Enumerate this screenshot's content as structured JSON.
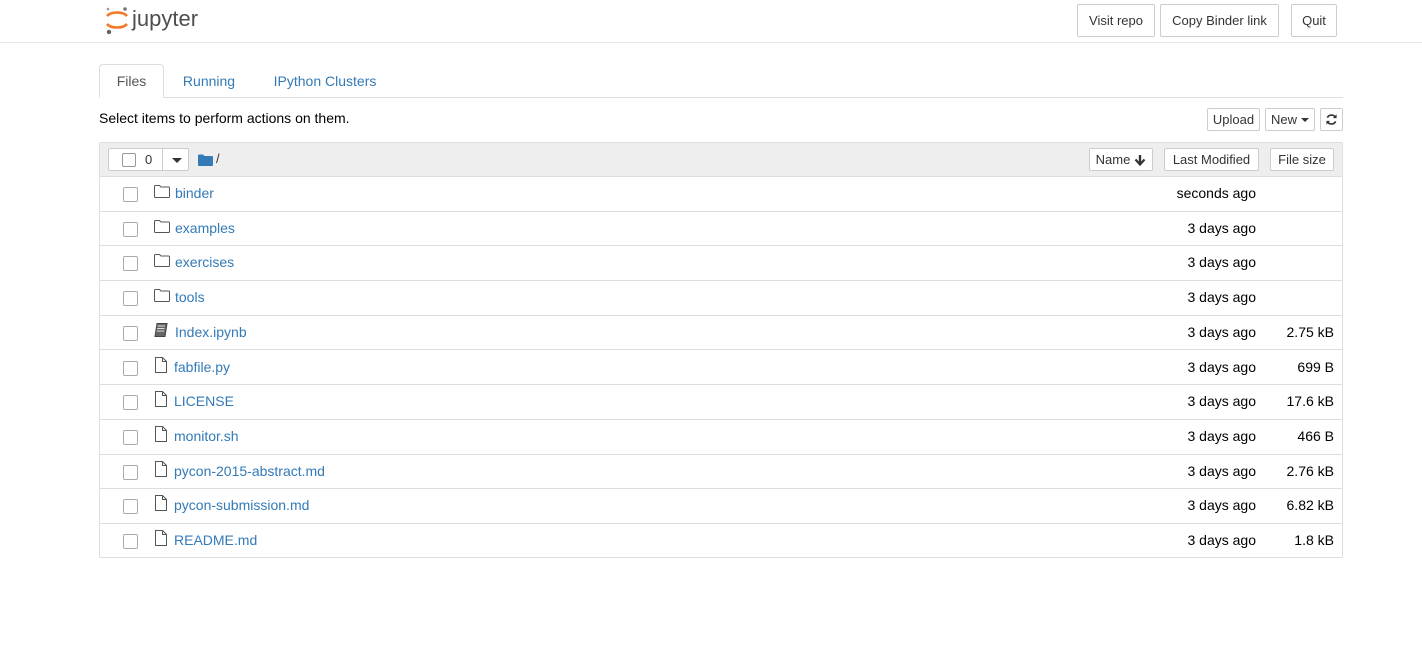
{
  "header": {
    "logo_text": "jupyter",
    "buttons": {
      "visit_repo": "Visit repo",
      "copy_binder_link": "Copy Binder link",
      "quit": "Quit"
    }
  },
  "tabs": [
    {
      "label": "Files",
      "active": true
    },
    {
      "label": "Running",
      "active": false
    },
    {
      "label": "IPython Clusters",
      "active": false
    }
  ],
  "toolbar": {
    "hint": "Select items to perform actions on them.",
    "upload_label": "Upload",
    "new_label": "New",
    "refresh_icon": "refresh-icon"
  },
  "list_header": {
    "selected_count": "0",
    "breadcrumb_icon": "folder-icon",
    "breadcrumb_path": "/",
    "sort_name_label": "Name",
    "sort_name_icon": "arrow-down-icon",
    "sort_modified_label": "Last Modified",
    "sort_size_label": "File size"
  },
  "items": [
    {
      "name": "binder",
      "type": "folder",
      "modified": "seconds ago",
      "size": ""
    },
    {
      "name": "examples",
      "type": "folder",
      "modified": "3 days ago",
      "size": ""
    },
    {
      "name": "exercises",
      "type": "folder",
      "modified": "3 days ago",
      "size": ""
    },
    {
      "name": "tools",
      "type": "folder",
      "modified": "3 days ago",
      "size": ""
    },
    {
      "name": "Index.ipynb",
      "type": "notebook",
      "modified": "3 days ago",
      "size": "2.75 kB"
    },
    {
      "name": "fabfile.py",
      "type": "file",
      "modified": "3 days ago",
      "size": "699 B"
    },
    {
      "name": "LICENSE",
      "type": "file",
      "modified": "3 days ago",
      "size": "17.6 kB"
    },
    {
      "name": "monitor.sh",
      "type": "file",
      "modified": "3 days ago",
      "size": "466 B"
    },
    {
      "name": "pycon-2015-abstract.md",
      "type": "file",
      "modified": "3 days ago",
      "size": "2.76 kB"
    },
    {
      "name": "pycon-submission.md",
      "type": "file",
      "modified": "3 days ago",
      "size": "6.82 kB"
    },
    {
      "name": "README.md",
      "type": "file",
      "modified": "3 days ago",
      "size": "1.8 kB"
    }
  ],
  "colors": {
    "link": "#337ab7",
    "brand_orange": "#f37726",
    "header_border": "#e7e7e7",
    "list_header_bg": "#eeeeee"
  }
}
